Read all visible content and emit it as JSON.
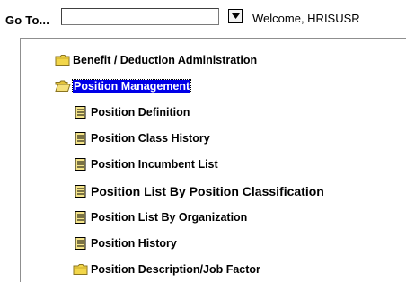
{
  "toolbar": {
    "goto_label": "Go To...",
    "goto_value": "",
    "welcome_text": "Welcome, HRISUSR"
  },
  "tree": {
    "items": [
      {
        "label": "Benefit / Deduction Administration",
        "icon": "folder-closed-icon"
      },
      {
        "label": "Position Management",
        "icon": "folder-open-icon",
        "selected": true
      },
      {
        "label": "Position Definition",
        "icon": "document-icon"
      },
      {
        "label": "Position Class History",
        "icon": "document-icon"
      },
      {
        "label": "Position Incumbent List",
        "icon": "document-icon"
      },
      {
        "label": "Position List By Position Classification",
        "icon": "document-icon"
      },
      {
        "label": "Position List By Organization",
        "icon": "document-icon"
      },
      {
        "label": "Position History",
        "icon": "document-icon"
      },
      {
        "label": "Position Description/Job Factor",
        "icon": "folder-closed-icon"
      }
    ]
  },
  "colors": {
    "selection": "#0000e8",
    "folder": "#f2d64a",
    "document": "#f5e58a"
  }
}
